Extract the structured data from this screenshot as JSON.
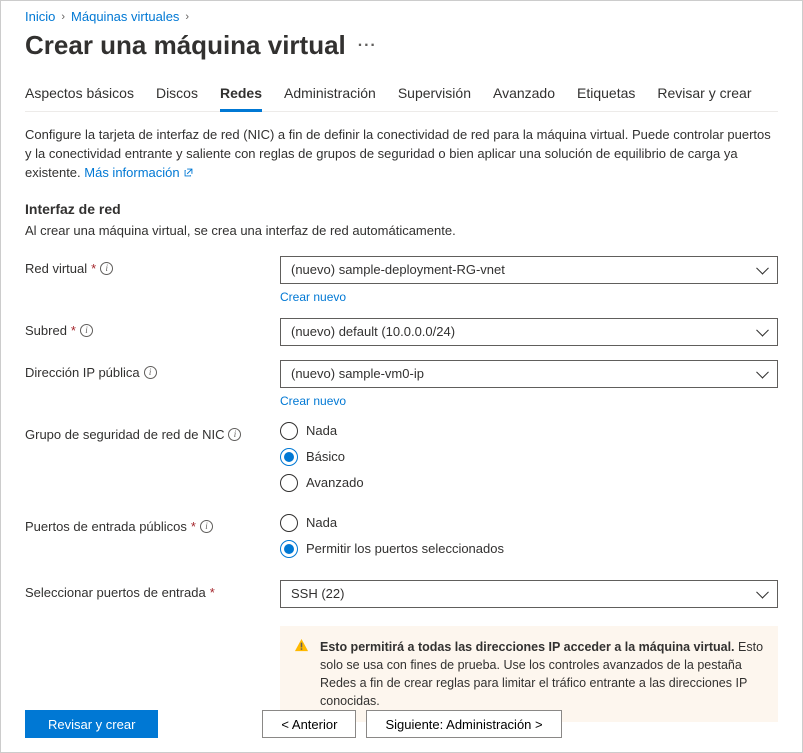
{
  "breadcrumb": {
    "home": "Inicio",
    "vms": "Máquinas virtuales"
  },
  "title": "Crear una máquina virtual",
  "tabs": {
    "basics": "Aspectos básicos",
    "disks": "Discos",
    "networking": "Redes",
    "management": "Administración",
    "monitoring": "Supervisión",
    "advanced": "Avanzado",
    "tags": "Etiquetas",
    "review": "Revisar y crear"
  },
  "intro": {
    "text": "Configure la tarjeta de interfaz de red (NIC) a fin de definir la conectividad de red para la máquina virtual. Puede controlar puertos y la conectividad entrante y saliente con reglas de grupos de seguridad o bien aplicar una solución de equilibrio de carga ya existente. ",
    "learn_more": "Más información"
  },
  "section": {
    "heading": "Interfaz de red",
    "subtext": "Al crear una máquina virtual, se crea una interfaz de red automáticamente."
  },
  "fields": {
    "vnet": {
      "label": "Red virtual",
      "value": "(nuevo) sample-deployment-RG-vnet",
      "create": "Crear nuevo"
    },
    "subnet": {
      "label": "Subred",
      "value": "(nuevo) default (10.0.0.0/24)"
    },
    "pip": {
      "label": "Dirección IP pública",
      "value": "(nuevo) sample-vm0-ip",
      "create": "Crear nuevo"
    },
    "nsg": {
      "label": "Grupo de seguridad de red de NIC",
      "options": {
        "none": "Nada",
        "basic": "Básico",
        "advanced": "Avanzado"
      }
    },
    "inbound": {
      "label": "Puertos de entrada públicos",
      "options": {
        "none": "Nada",
        "allow": "Permitir los puertos seleccionados"
      }
    },
    "ports": {
      "label": "Seleccionar puertos de entrada",
      "value": "SSH (22)"
    }
  },
  "warning": {
    "bold": "Esto permitirá a todas las direcciones IP acceder a la máquina virtual.",
    "rest": " Esto solo se usa con fines de prueba. Use los controles avanzados de la pestaña Redes a fin de crear reglas para limitar el tráfico entrante a las direcciones IP conocidas."
  },
  "footer": {
    "review": "Revisar y crear",
    "prev": "<  Anterior",
    "next": "Siguiente: Administración  >"
  }
}
